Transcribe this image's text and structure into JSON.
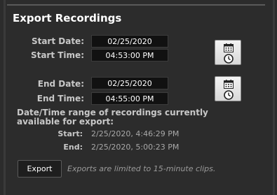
{
  "export": {
    "title": "Export Recordings",
    "start_date_label": "Start Date:",
    "start_date_value": "02/25/2020",
    "start_time_label": "Start Time:",
    "start_time_value": "04:53:00 PM",
    "end_date_label": "End Date:",
    "end_date_value": "02/25/2020",
    "end_time_label": "End Time:",
    "end_time_value": "04:55:00 PM",
    "range_title": "Date/Time range of recordings currently available for export:",
    "range_start_label": "Start:",
    "range_start_value": "2/25/2020, 4:46:29 PM",
    "range_end_label": "End:",
    "range_end_value": "2/25/2020, 5:00:23 PM",
    "export_button_label": "Export",
    "note": "Exports are limited to 15-minute clips."
  },
  "icons": {
    "calendar": "calendar-icon",
    "clock": "clock-icon"
  }
}
